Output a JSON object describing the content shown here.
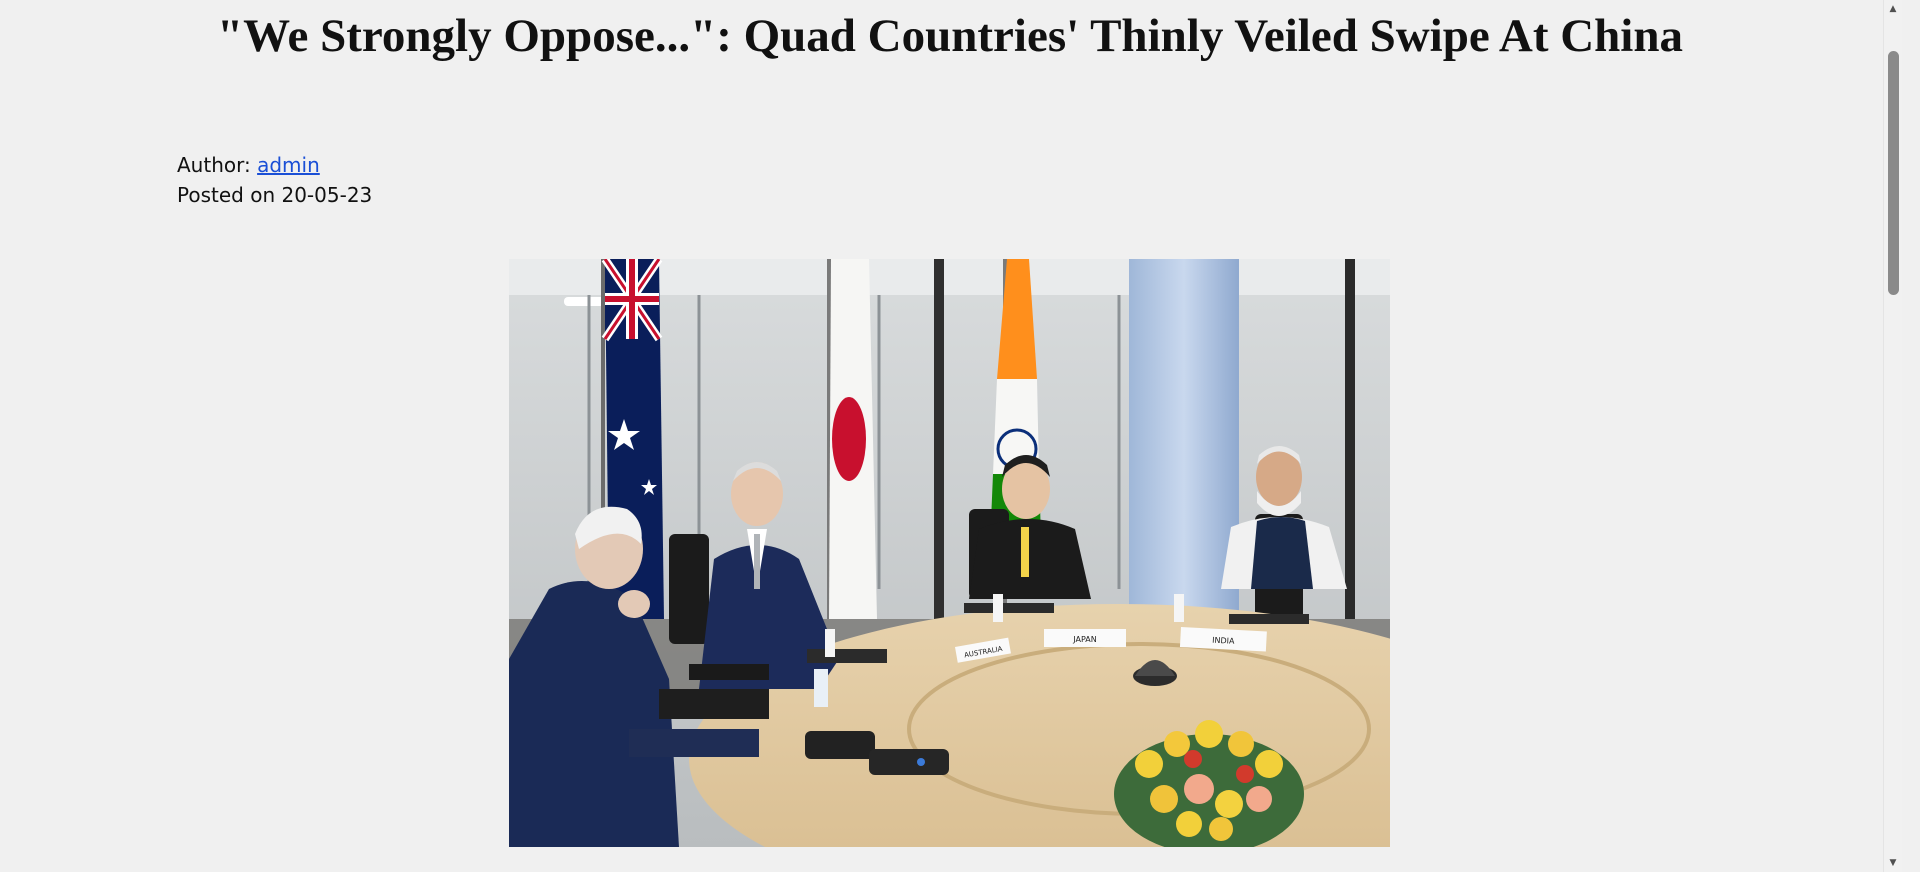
{
  "article": {
    "title": "\"We Strongly Oppose...\": Quad Countries' Thinly Veiled Swipe At China",
    "author_label": "Author:",
    "author_name": "admin",
    "posted_label": "Posted on",
    "posted_date": "20-05-23"
  },
  "image": {
    "name_plates": [
      "AUSTRALIA",
      "JAPAN",
      "INDIA"
    ]
  },
  "colors": {
    "background": "#f0f0f0",
    "link": "#1a4fd6",
    "text": "#111111"
  },
  "icons": {
    "scroll_up": "chevron-up-icon",
    "scroll_down": "chevron-down-icon"
  }
}
